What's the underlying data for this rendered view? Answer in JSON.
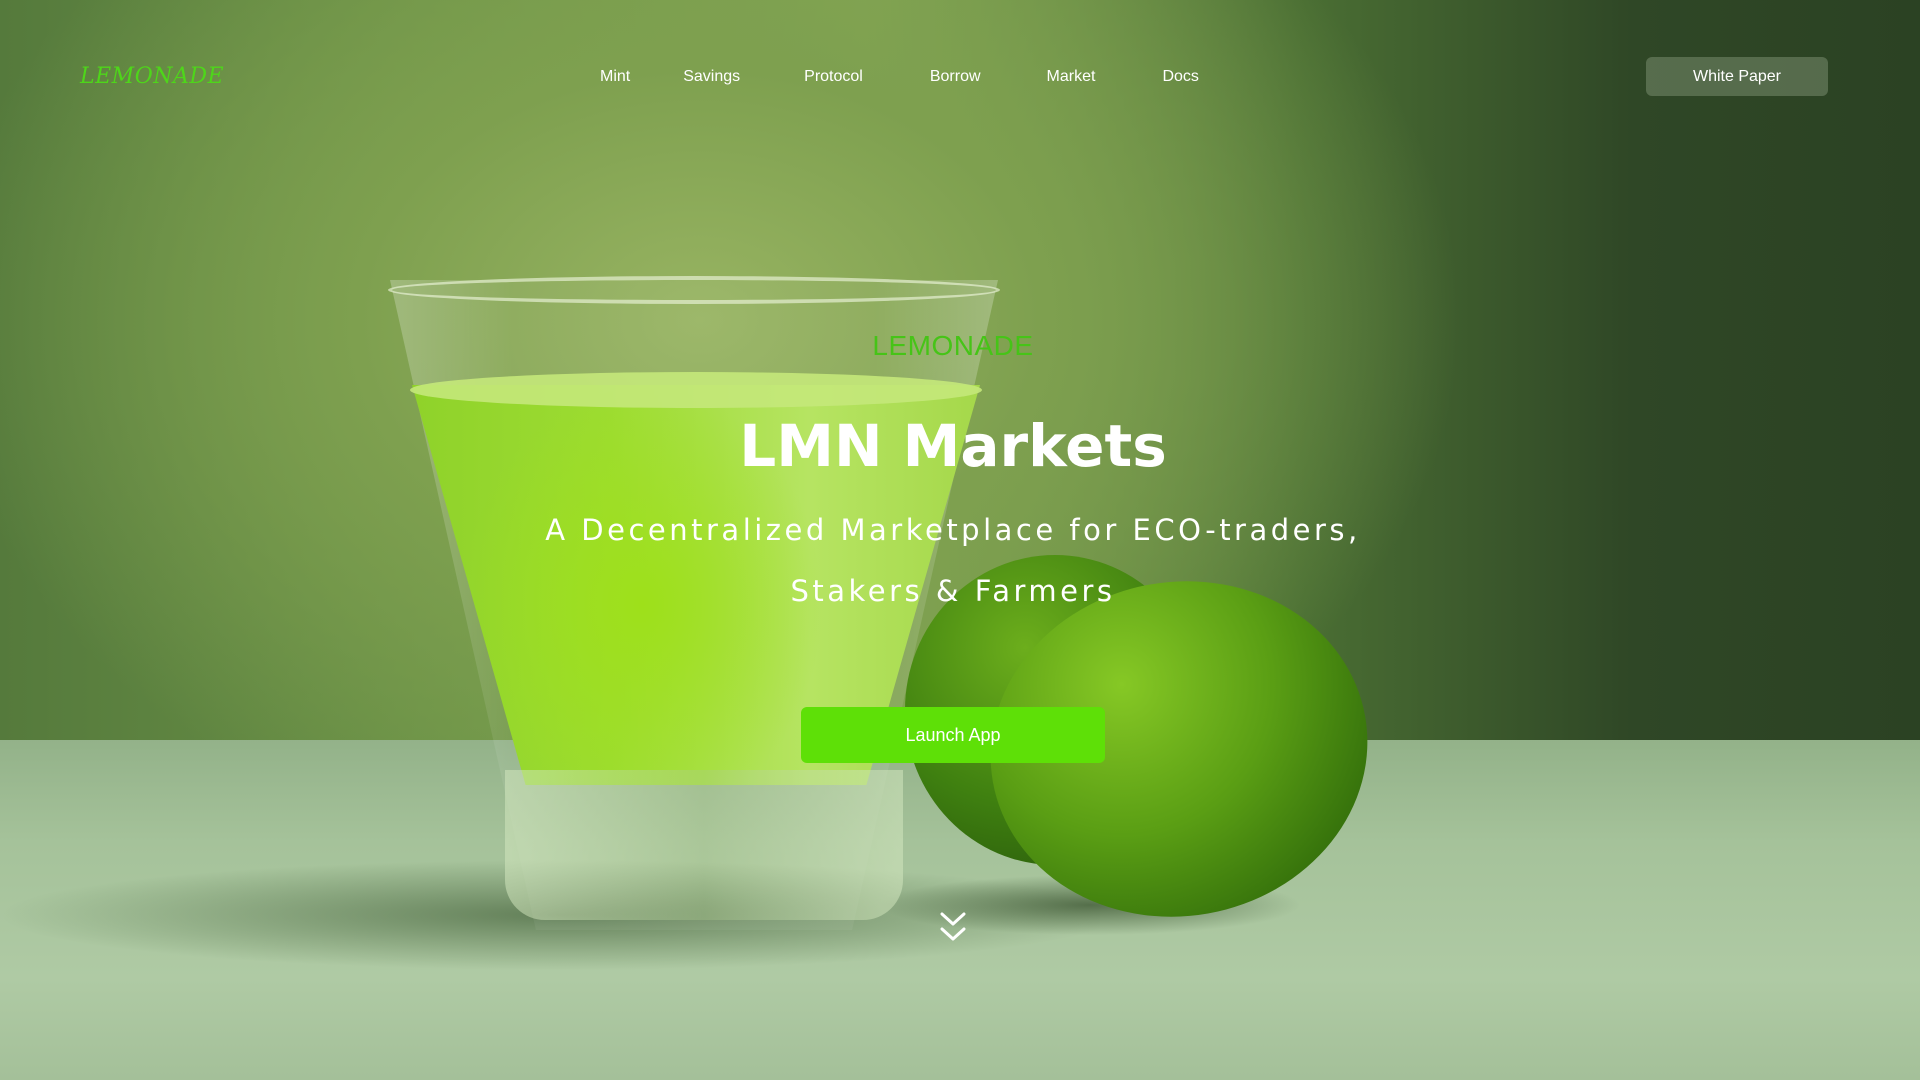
{
  "brand": {
    "logo_text": "LEMONADE"
  },
  "nav": {
    "items": [
      {
        "label": "Mint"
      },
      {
        "label": "Savings"
      },
      {
        "label": "Protocol"
      },
      {
        "label": "Borrow"
      },
      {
        "label": "Market"
      },
      {
        "label": "Docs"
      }
    ],
    "cta_label": "White Paper"
  },
  "hero": {
    "eyebrow": "LEMONADE",
    "headline": "LMN Markets",
    "subline_1": "A Decentralized Marketplace for ECO-traders,",
    "subline_2": "Stakers & Farmers",
    "launch_label": "Launch App",
    "scroll_icon": "double-chevron-down-icon"
  },
  "colors": {
    "accent_green": "#5ee007",
    "logo_green": "#4ed61a"
  }
}
